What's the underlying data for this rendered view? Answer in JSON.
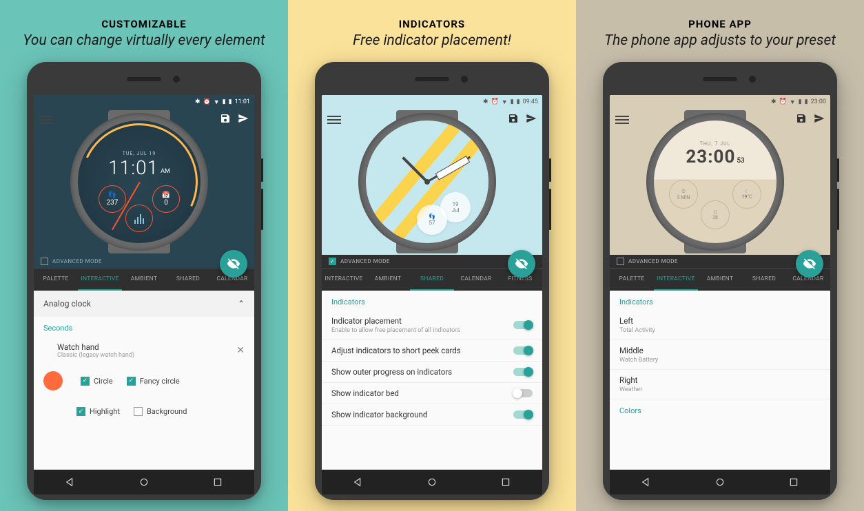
{
  "panels": [
    {
      "title": "CUSTOMIZABLE",
      "subtitle": "You can change virtually every element",
      "bg": "#6bc4b8"
    },
    {
      "title": "INDICATORS",
      "subtitle": "Free indicator placement!",
      "bg": "#fbe29a"
    },
    {
      "title": "PHONE APP",
      "subtitle": "The phone app adjusts to your preset",
      "bg": "#c7beaa"
    }
  ],
  "status_times": [
    "11:01",
    "09:45",
    "23:00"
  ],
  "adv_mode_label": "ADVANCED MODE",
  "phone1": {
    "header_bg": "#2a4552",
    "adv_checked": false,
    "tabs": [
      "PALETTE",
      "INTERACTIVE",
      "AMBIENT",
      "SHARED",
      "CALENDAR"
    ],
    "tab_active": 1,
    "accordion": "Analog clock",
    "section": "Seconds",
    "watch_hand_title": "Watch hand",
    "watch_hand_sub": "Classic (legacy watch hand)",
    "checkboxes": [
      {
        "label": "Circle",
        "on": true
      },
      {
        "label": "Fancy circle",
        "on": true
      },
      {
        "label": "Highlight",
        "on": true
      },
      {
        "label": "Background",
        "on": false
      }
    ],
    "face": {
      "date": "TUE, JUL 19",
      "time": "11:01",
      "ampm": "AM",
      "sub1_icon": "👣",
      "sub1_val": "237",
      "sub2_icon": "📅",
      "sub2_val": "0"
    }
  },
  "phone2": {
    "header_bg": "#c5e8ef",
    "adv_checked": true,
    "tabs": [
      "INTERACTIVE",
      "AMBIENT",
      "SHARED",
      "CALENDAR",
      "FITNESS"
    ],
    "tab_active": 2,
    "section": "Indicators",
    "items": [
      {
        "title": "Indicator placement",
        "sub": "Enable to allow free placement of all indicators",
        "on": true
      },
      {
        "title": "Adjust indicators to short peek cards",
        "sub": "",
        "on": true
      },
      {
        "title": "Show outer progress on indicators",
        "sub": "",
        "on": true
      },
      {
        "title": "Show indicator bed",
        "sub": "",
        "on": false
      },
      {
        "title": "Show indicator background",
        "sub": "",
        "on": true
      }
    ],
    "face": {
      "bubble1_line1": "19",
      "bubble1_line2": "Jul",
      "bubble2_val": "57"
    }
  },
  "phone3": {
    "header_bg": "#d8cdb6",
    "adv_checked": false,
    "tabs": [
      "PALETTE",
      "INTERACTIVE",
      "AMBIENT",
      "SHARED",
      "CALENDAR"
    ],
    "tab_active": 1,
    "section": "Indicators",
    "items": [
      {
        "title": "Left",
        "sub": "Total Activity"
      },
      {
        "title": "Middle",
        "sub": "Watch Battery"
      },
      {
        "title": "Right",
        "sub": "Weather"
      }
    ],
    "section2": "Colors",
    "face": {
      "date": "THU, 7 JUL",
      "time": "23:00",
      "sec": "53",
      "r1": "5 MIN",
      "r2_val": "19",
      "r2_unit": "°C",
      "r3_val": "38"
    }
  }
}
